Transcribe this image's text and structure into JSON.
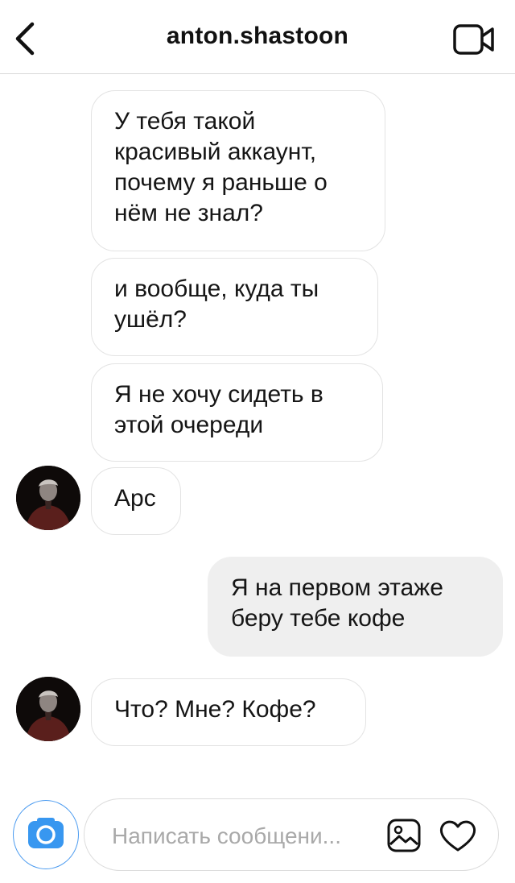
{
  "header": {
    "title": "anton.shastoon"
  },
  "messages": [
    {
      "sender": "them",
      "text": "У тебя такой красивый аккаунт, почему я раньше о нём не знал?"
    },
    {
      "sender": "them",
      "text": "и вообще, куда ты ушёл?"
    },
    {
      "sender": "them",
      "text": "Я не хочу сидеть в этой очереди"
    },
    {
      "sender": "them",
      "text": "Арс"
    },
    {
      "sender": "me",
      "text": "Я на первом этаже беру тебе кофе"
    },
    {
      "sender": "them",
      "text": "Что? Мне? Кофе?"
    }
  ],
  "composer": {
    "placeholder": "Написать сообщени..."
  },
  "icons": {
    "back": "chevron-left-icon",
    "video": "video-camera-icon",
    "camera": "camera-icon",
    "gallery": "gallery-icon",
    "heart": "heart-icon"
  },
  "colors": {
    "camera_button": "#3897f0",
    "sent_bubble": "#efefef"
  }
}
